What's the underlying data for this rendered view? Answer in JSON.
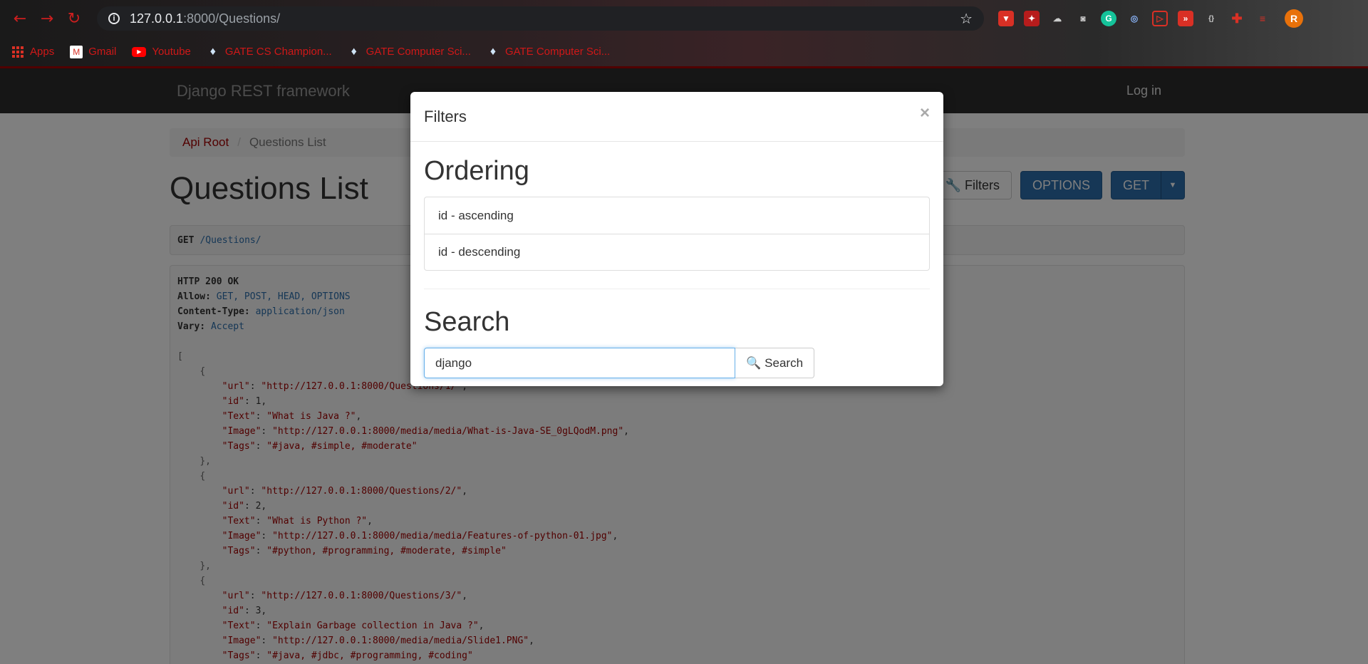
{
  "browser": {
    "url_host": "127.0.0.1",
    "url_path": ":8000/Questions/",
    "profile_initial": "R",
    "bookmarks": [
      {
        "label": "Apps",
        "icon": "apps-grid-icon"
      },
      {
        "label": "Gmail",
        "icon": "gmail-icon"
      },
      {
        "label": "Youtube",
        "icon": "youtube-icon"
      },
      {
        "label": "GATE CS Champion...",
        "icon": "gate-icon"
      },
      {
        "label": "GATE Computer Sci...",
        "icon": "gate-icon"
      },
      {
        "label": "GATE Computer Sci...",
        "icon": "gate-icon"
      }
    ]
  },
  "navbar": {
    "brand": "Django REST framework",
    "login": "Log in"
  },
  "breadcrumb": {
    "root": "Api Root",
    "separator": "/",
    "current": "Questions List"
  },
  "page": {
    "title": "Questions List",
    "filters_button": "Filters",
    "options_button": "OPTIONS",
    "get_button": "GET"
  },
  "request": {
    "method": "GET",
    "url": "/Questions/"
  },
  "response": {
    "status": "HTTP 200 OK",
    "headers": [
      {
        "key": "Allow:",
        "value": "GET, POST, HEAD, OPTIONS"
      },
      {
        "key": "Content-Type:",
        "value": "application/json"
      },
      {
        "key": "Vary:",
        "value": "Accept"
      }
    ],
    "items": [
      {
        "url": "\"http://127.0.0.1:8000/Questions/1/\"",
        "id": "1",
        "text": "\"What is Java ?\"",
        "image": "\"http://127.0.0.1:8000/media/media/What-is-Java-SE_0gLQodM.png\"",
        "tags": "\"#java, #simple, #moderate\""
      },
      {
        "url": "\"http://127.0.0.1:8000/Questions/2/\"",
        "id": "2",
        "text": "\"What is Python ?\"",
        "image": "\"http://127.0.0.1:8000/media/media/Features-of-python-01.jpg\"",
        "tags": "\"#python, #programming, #moderate, #simple\""
      },
      {
        "url": "\"http://127.0.0.1:8000/Questions/3/\"",
        "id": "3",
        "text": "\"Explain Garbage collection in Java ?\"",
        "image": "\"http://127.0.0.1:8000/media/media/Slide1.PNG\"",
        "tags": "\"#java, #jdbc, #programming, #coding\""
      }
    ]
  },
  "modal": {
    "title": "Filters",
    "close": "×",
    "ordering_heading": "Ordering",
    "ordering_options": [
      "id - ascending",
      "id - descending"
    ],
    "search_heading": "Search",
    "search_value": "django",
    "search_button": "Search"
  }
}
